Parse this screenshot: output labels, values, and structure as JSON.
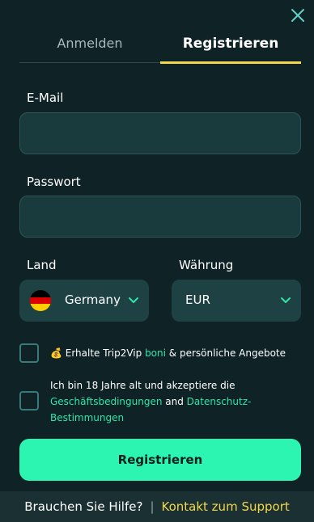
{
  "tabs": {
    "login": "Anmelden",
    "register": "Registrieren"
  },
  "form": {
    "email_label": "E-Mail",
    "email_value": "",
    "password_label": "Passwort",
    "password_value": "",
    "country_label": "Land",
    "country_value": "Germany",
    "country_flag": "germany-flag-icon",
    "currency_label": "Währung",
    "currency_value": "EUR"
  },
  "consents": {
    "bonus_prefix": "💰 Erhalte Trip2Vip ",
    "bonus_link": "boni",
    "bonus_suffix": " & persönliche Angebote",
    "terms_prefix": "Ich bin 18 Jahre alt und akzeptiere die",
    "terms_link": "Geschäftsbedingungen",
    "terms_and": " and ",
    "privacy_link": "Datenschutz-Bestimmungen"
  },
  "submit_label": "Registrieren",
  "footer": {
    "help_text": "Brauchen Sie Hilfe?",
    "separator": "|",
    "support_link": "Kontakt zum Support"
  },
  "colors": {
    "background": "#0f2226",
    "accent_yellow": "#f2d74c",
    "accent_green": "#2bf5b0",
    "link_green": "#2ee6a8"
  }
}
